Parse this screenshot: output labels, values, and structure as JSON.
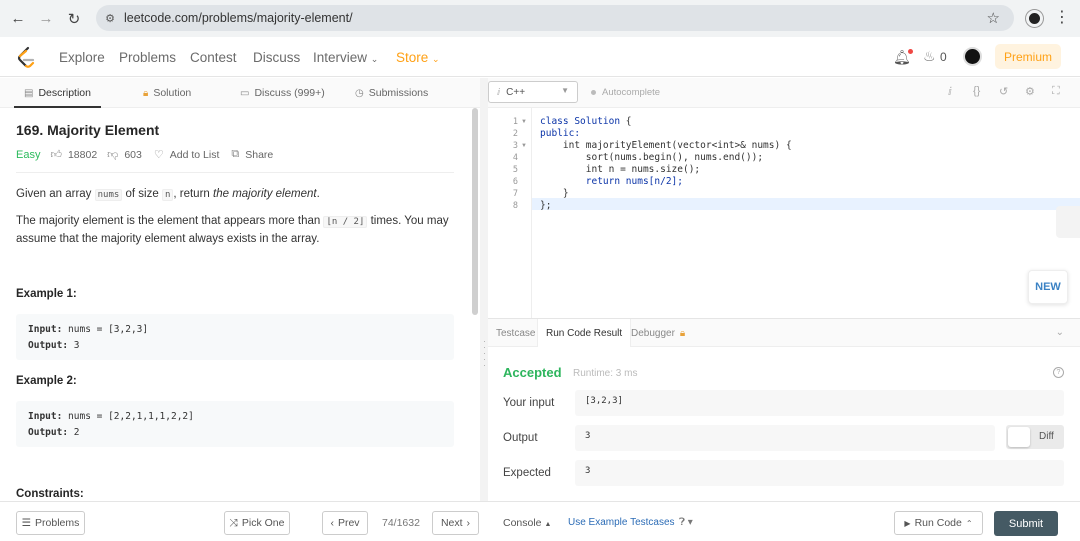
{
  "browser": {
    "back": "←",
    "forward": "→",
    "reload": "↻",
    "url": "leetcode.com/problems/majority-element/"
  },
  "nav": {
    "links": [
      "Explore",
      "Problems",
      "Contest",
      "Discuss",
      "Interview",
      "Store"
    ],
    "fire_count": "0",
    "premium": "Premium"
  },
  "left_tabs": {
    "description": "Description",
    "solution": "Solution",
    "discuss": "Discuss (999+)",
    "submissions": "Submissions"
  },
  "problem": {
    "title": "169. Majority Element",
    "difficulty": "Easy",
    "likes": "18802",
    "dislikes": "603",
    "add_to_list": "Add to List",
    "share": "Share",
    "para1_a": "Given an array ",
    "para1_code1": "nums",
    "para1_b": " of size ",
    "para1_code2": "n",
    "para1_c": ", return ",
    "para1_em": "the majority element",
    "para1_d": ".",
    "para2_a": "The majority element is the element that appears more than ",
    "para2_code": "⌊n / 2⌋",
    "para2_b": " times. You may assume that the majority element always exists in the array.",
    "example1_heading": "Example 1:",
    "example1_input_label": "Input:",
    "example1_input": " nums = [3,2,3]",
    "example1_output_label": "Output:",
    "example1_output": " 3",
    "example2_heading": "Example 2:",
    "example2_input_label": "Input:",
    "example2_input": " nums = [2,2,1,1,1,2,2]",
    "example2_output_label": "Output:",
    "example2_output": " 2",
    "constraints_heading": "Constraints:"
  },
  "editor": {
    "language": "C++",
    "autocomplete": "Autocomplete",
    "new_badge": "NEW",
    "line_numbers": [
      "1",
      "2",
      "3",
      "4",
      "5",
      "6",
      "7",
      "8"
    ],
    "code": [
      {
        "kw": "class Solution",
        "rest": " {"
      },
      {
        "kw": "public:",
        "rest": ""
      },
      {
        "kw": "",
        "rest": "    int majorityElement(vector<int>& nums) {"
      },
      {
        "kw": "",
        "rest": "        sort(nums.begin(), nums.end());"
      },
      {
        "kw": "",
        "rest": "        int n = nums.size();"
      },
      {
        "kw": "",
        "rest": "        return nums[n/2];"
      },
      {
        "kw": "",
        "rest": "    }"
      },
      {
        "kw": "",
        "rest": "};"
      }
    ]
  },
  "result": {
    "tabs": [
      "Testcase",
      "Run Code Result",
      "Debugger"
    ],
    "status": "Accepted",
    "runtime": "Runtime: 3 ms",
    "your_input_label": "Your input",
    "your_input": "[3,2,3]",
    "output_label": "Output",
    "output": "3",
    "expected_label": "Expected",
    "expected": "3",
    "diff": "Diff"
  },
  "bottom": {
    "problems": "Problems",
    "pick_one": "Pick One",
    "prev": "Prev",
    "page": "74/1632",
    "next": "Next",
    "console": "Console",
    "use_example": "Use Example Testcases",
    "run_code": "Run Code",
    "submit": "Submit"
  }
}
